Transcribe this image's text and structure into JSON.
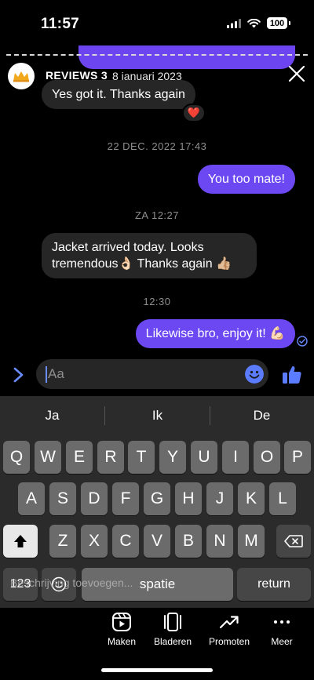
{
  "status_bar": {
    "time": "11:57",
    "battery": "100"
  },
  "story_header": {
    "name": "REVIEWS 3",
    "date": "8 januari 2023"
  },
  "messages": [
    {
      "text": "Yes got it. Thanks again",
      "reaction": "❤️"
    },
    {
      "timestamp": "22 DEC. 2022 17:43"
    },
    {
      "text": "You too mate!"
    },
    {
      "timestamp": "ZA 12:27"
    },
    {
      "text_line1": "Jacket arrived today. Looks",
      "text_line2": "tremendous👌🏻 Thanks again 👍🏼"
    },
    {
      "timestamp": "12:30"
    },
    {
      "text": "Likewise bro, enjoy it! 💪🏻"
    }
  ],
  "composer": {
    "placeholder": "Aa"
  },
  "keyboard": {
    "suggestions": [
      "Ja",
      "Ik",
      "De"
    ],
    "row1": [
      "Q",
      "W",
      "E",
      "R",
      "T",
      "Y",
      "U",
      "I",
      "O",
      "P"
    ],
    "row2": [
      "A",
      "S",
      "D",
      "F",
      "G",
      "H",
      "J",
      "K",
      "L"
    ],
    "row3": [
      "Z",
      "X",
      "C",
      "V",
      "B",
      "N",
      "M"
    ],
    "numbers_key": "123",
    "space_key": "spatie",
    "return_key": "return",
    "caption_ghost": "Beschrijving toevoegen..."
  },
  "toolbar": [
    {
      "label": "Maken",
      "icon": "reels-icon"
    },
    {
      "label": "Bladeren",
      "icon": "carousel-icon"
    },
    {
      "label": "Promoten",
      "icon": "trending-up-icon"
    },
    {
      "label": "Meer",
      "icon": "more-icon"
    }
  ],
  "colors": {
    "outgoing_bubble": "#6b48f2",
    "incoming_bubble": "#262626",
    "accent_blue": "#5b7cff"
  }
}
